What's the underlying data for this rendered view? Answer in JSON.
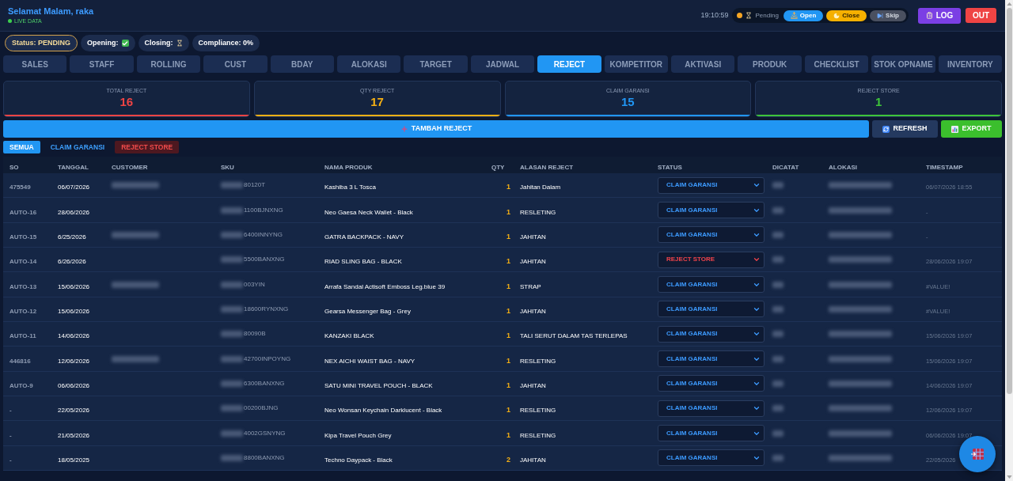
{
  "header": {
    "greeting": "Selamat Malam, raka",
    "live_label": "LIVE DATA",
    "time": "19:10:59",
    "pending_label": "Pending",
    "shift_buttons": [
      {
        "label": "Open",
        "kind": "open"
      },
      {
        "label": "Close",
        "kind": "close"
      },
      {
        "label": "Skip",
        "kind": "skip"
      }
    ],
    "log_button": "LOG",
    "out_button": "OUT"
  },
  "status_chips": [
    {
      "kind": "status",
      "label": "Status: PENDING"
    },
    {
      "kind": "check",
      "label": "Opening:",
      "done": true
    },
    {
      "kind": "check",
      "label": "Closing:",
      "done": false
    },
    {
      "kind": "text",
      "label": "Compliance: 0%"
    }
  ],
  "tabs": [
    {
      "label": "SALES",
      "selected": false
    },
    {
      "label": "STAFF",
      "selected": false
    },
    {
      "label": "ROLLING",
      "selected": false
    },
    {
      "label": "CUST",
      "selected": false
    },
    {
      "label": "BDAY",
      "selected": false
    },
    {
      "label": "ALOKASI",
      "selected": false
    },
    {
      "label": "TARGET",
      "selected": false
    },
    {
      "label": "JADWAL",
      "selected": false
    },
    {
      "label": "REJECT",
      "selected": true
    },
    {
      "label": "KOMPETITOR",
      "selected": false
    },
    {
      "label": "AKTIVASI",
      "selected": false
    },
    {
      "label": "PRODUK",
      "selected": false
    },
    {
      "label": "CHECKLIST",
      "selected": false
    },
    {
      "label": "STOK OPNAME",
      "selected": false
    },
    {
      "label": "INVENTORY",
      "selected": false
    }
  ],
  "stats": [
    {
      "label": "TOTAL REJECT",
      "value": "16",
      "color": "#ef4444"
    },
    {
      "label": "QTY REJECT",
      "value": "17",
      "color": "#f5b014"
    },
    {
      "label": "CLAIM GARANSI",
      "value": "15",
      "color": "#2196f3"
    },
    {
      "label": "REJECT STORE",
      "value": "1",
      "color": "#3ec43a"
    }
  ],
  "actions": {
    "add": "TAMBAH REJECT",
    "refresh": "REFRESH",
    "export": "EXPORT"
  },
  "filters": [
    {
      "label": "SEMUA",
      "kind": "all",
      "selected": true
    },
    {
      "label": "CLAIM GARANSI",
      "kind": "claim",
      "selected": false
    },
    {
      "label": "REJECT STORE",
      "kind": "reject",
      "selected": false
    }
  ],
  "table": {
    "columns": [
      "SO",
      "TANGGAL",
      "CUSTOMER",
      "SKU",
      "NAMA PRODUK",
      "QTY",
      "ALASAN REJECT",
      "STATUS",
      "DICATAT",
      "ALOKASI",
      "TIMESTAMP"
    ],
    "rows": [
      {
        "so": "475549",
        "tanggal": "06/07/2026",
        "customer_redacted": true,
        "sku": "80120T",
        "nama_produk": "Kashiba 3 L Tosca",
        "qty": "1",
        "alasan": "Jahitan Dalam",
        "status": {
          "value": "CLAIM GARANSI",
          "kind": "claim"
        },
        "timestamp": "06/07/2026 18:55"
      },
      {
        "so": "AUTO-16",
        "tanggal": "28/06/2026",
        "customer_redacted": false,
        "sku": "1100BJNXNG",
        "nama_produk": "Neo Gaesa Neck Wallet - Black",
        "qty": "1",
        "alasan": "RESLETING",
        "status": {
          "value": "CLAIM GARANSI",
          "kind": "claim"
        },
        "timestamp": "-"
      },
      {
        "so": "AUTO-15",
        "tanggal": "6/25/2026",
        "customer_redacted": true,
        "sku": "6400INNYNG",
        "nama_produk": "GATRA BACKPACK - NAVY",
        "qty": "1",
        "alasan": "JAHITAN",
        "status": {
          "value": "CLAIM GARANSI",
          "kind": "claim"
        },
        "timestamp": "-"
      },
      {
        "so": "AUTO-14",
        "tanggal": "6/26/2026",
        "customer_redacted": false,
        "sku": "5500BANXNG",
        "nama_produk": "RIAD SLING BAG - BLACK",
        "qty": "1",
        "alasan": "JAHITAN",
        "status": {
          "value": "REJECT STORE",
          "kind": "reject"
        },
        "timestamp": "28/06/2026 19:07"
      },
      {
        "so": "AUTO-13",
        "tanggal": "15/06/2026",
        "customer_redacted": true,
        "sku": "003YIN",
        "nama_produk": "Arrafa Sandal Actisoft Emboss Leg.blue 39",
        "qty": "1",
        "alasan": "STRAP",
        "status": {
          "value": "CLAIM GARANSI",
          "kind": "claim"
        },
        "timestamp": "#VALUE!"
      },
      {
        "so": "AUTO-12",
        "tanggal": "15/06/2026",
        "customer_redacted": false,
        "sku": "18600RYNXNG",
        "nama_produk": "Gearsa Messenger Bag - Grey",
        "qty": "1",
        "alasan": "JAHITAN",
        "status": {
          "value": "CLAIM GARANSI",
          "kind": "claim"
        },
        "timestamp": "#VALUE!"
      },
      {
        "so": "AUTO-11",
        "tanggal": "14/06/2026",
        "customer_redacted": false,
        "sku": "80090B",
        "nama_produk": "KANZAKI BLACK",
        "qty": "1",
        "alasan": "TALI SERUT DALAM TAS TERLEPAS",
        "status": {
          "value": "CLAIM GARANSI",
          "kind": "claim"
        },
        "timestamp": "15/06/2026 19:07"
      },
      {
        "so": "446816",
        "tanggal": "12/06/2026",
        "customer_redacted": true,
        "sku": "42700INPOYNG",
        "nama_produk": "NEX AICHI WAIST BAG - NAVY",
        "qty": "1",
        "alasan": "RESLETING",
        "status": {
          "value": "CLAIM GARANSI",
          "kind": "claim"
        },
        "timestamp": "15/06/2026 19:07"
      },
      {
        "so": "AUTO-9",
        "tanggal": "06/06/2026",
        "customer_redacted": false,
        "sku": "6300BANXNG",
        "nama_produk": "SATU MINI TRAVEL POUCH - BLACK",
        "qty": "1",
        "alasan": "JAHITAN",
        "status": {
          "value": "CLAIM GARANSI",
          "kind": "claim"
        },
        "timestamp": "14/06/2026 19:07"
      },
      {
        "so": "-",
        "tanggal": "22/05/2026",
        "customer_redacted": false,
        "sku": "00200BJNG",
        "nama_produk": "Neo Wonsan Keychain Darklucent - Black",
        "qty": "1",
        "alasan": "RESLETING",
        "status": {
          "value": "CLAIM GARANSI",
          "kind": "claim"
        },
        "timestamp": "12/06/2026 19:07"
      },
      {
        "so": "-",
        "tanggal": "21/05/2026",
        "customer_redacted": false,
        "sku": "4002GSNYNG",
        "nama_produk": "Kipa Travel Pouch Grey",
        "qty": "1",
        "alasan": "RESLETING",
        "status": {
          "value": "CLAIM GARANSI",
          "kind": "claim"
        },
        "timestamp": "06/06/2026 19:07"
      },
      {
        "so": "-",
        "tanggal": "18/05/2025",
        "customer_redacted": false,
        "sku": "8800BANXNG",
        "nama_produk": "Techno Daypack - Black",
        "qty": "2",
        "alasan": "JAHITAN",
        "status": {
          "value": "CLAIM GARANSI",
          "kind": "claim"
        },
        "timestamp": "22/05/2026"
      }
    ]
  }
}
